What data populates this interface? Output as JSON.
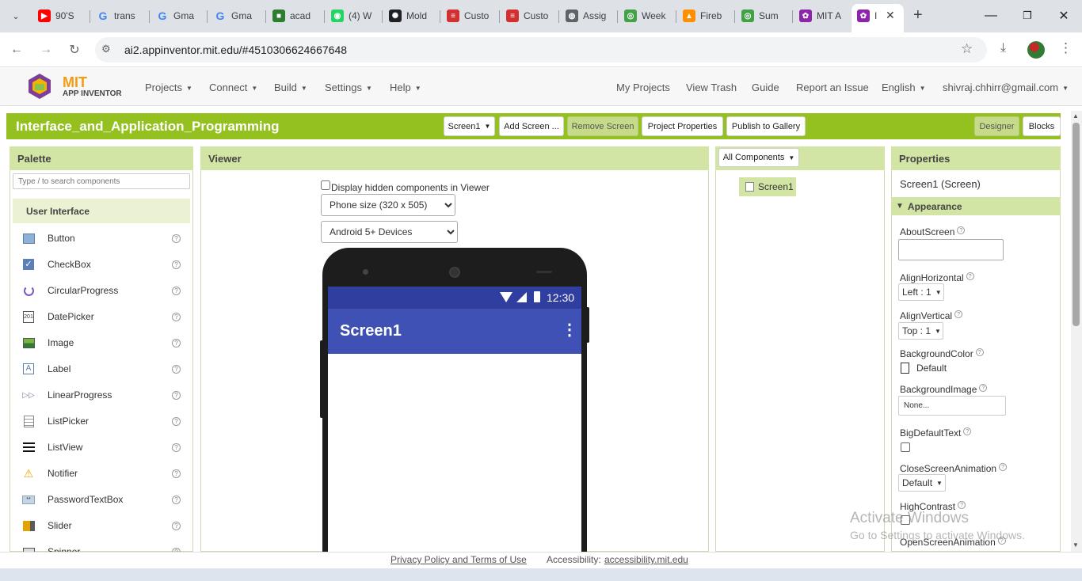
{
  "browser": {
    "tabs": [
      {
        "title": "90'S",
        "icon": "youtube-icon",
        "color": "#ff0000"
      },
      {
        "title": "trans",
        "icon": "google-icon",
        "color": "#4285f4"
      },
      {
        "title": "Gma",
        "icon": "google-icon",
        "color": "#4285f4"
      },
      {
        "title": "Gma",
        "icon": "google-icon",
        "color": "#4285f4"
      },
      {
        "title": "acad",
        "icon": "cube-icon",
        "color": "#2e7d32"
      },
      {
        "title": "(4) W",
        "icon": "whatsapp-icon",
        "color": "#25d366"
      },
      {
        "title": "Mold",
        "icon": "openai-icon",
        "color": "#202124"
      },
      {
        "title": "Custo",
        "icon": "form-icon",
        "color": "#d32f2f"
      },
      {
        "title": "Custo",
        "icon": "form-icon",
        "color": "#d32f2f"
      },
      {
        "title": "Assig",
        "icon": "globe-icon",
        "color": "#5f6368"
      },
      {
        "title": "Week",
        "icon": "chrome-icon",
        "color": "#43a047"
      },
      {
        "title": "Fireb",
        "icon": "firebase-icon",
        "color": "#ff8f00"
      },
      {
        "title": "Sum",
        "icon": "chrome-icon",
        "color": "#43a047"
      },
      {
        "title": "MIT A",
        "icon": "appinventor-icon",
        "color": "#8e24aa"
      },
      {
        "title": "I",
        "icon": "appinventor-icon",
        "color": "#8e24aa"
      }
    ],
    "new_tab": "+",
    "url": "ai2.appinventor.mit.edu/#4510306624667648"
  },
  "app": {
    "logo_mit": "MIT",
    "logo_sub": "APP INVENTOR",
    "menus": [
      "Projects",
      "Connect",
      "Build",
      "Settings",
      "Help"
    ],
    "right_links": [
      "My Projects",
      "View Trash",
      "Guide",
      "Report an Issue",
      "English",
      "shivraj.chhirr@gmail.com"
    ]
  },
  "toolbar": {
    "project_title": "Interface_and_Application_Programming",
    "screen_select": "Screen1",
    "add_screen": "Add Screen ...",
    "remove_screen": "Remove Screen",
    "project_properties": "Project Properties",
    "publish": "Publish to Gallery",
    "designer": "Designer",
    "blocks": "Blocks"
  },
  "palette": {
    "title": "Palette",
    "search_placeholder": "Type / to search components",
    "category": "User Interface",
    "items": [
      "Button",
      "CheckBox",
      "CircularProgress",
      "DatePicker",
      "Image",
      "Label",
      "LinearProgress",
      "ListPicker",
      "ListView",
      "Notifier",
      "PasswordTextBox",
      "Slider",
      "Spinner"
    ],
    "help": "?"
  },
  "viewer": {
    "title": "Viewer",
    "hidden_label": "Display hidden components in Viewer",
    "size_option": "Phone size (320 x 505)",
    "device_option": "Android 5+ Devices",
    "time": "12:30",
    "screen_title": "Screen1"
  },
  "components": {
    "dropdown": "All Components",
    "tree_item": "Screen1"
  },
  "properties": {
    "title": "Properties",
    "subtitle": "Screen1 (Screen)",
    "section": "Appearance",
    "about_label": "AboutScreen",
    "align_h_label": "AlignHorizontal",
    "align_h_value": "Left : 1",
    "align_v_label": "AlignVertical",
    "align_v_value": "Top : 1",
    "bg_color_label": "BackgroundColor",
    "bg_color_value": "Default",
    "bg_image_label": "BackgroundImage",
    "bg_image_value": "None...",
    "big_text_label": "BigDefaultText",
    "close_anim_label": "CloseScreenAnimation",
    "close_anim_value": "Default",
    "high_contrast_label": "HighContrast",
    "open_anim_label": "OpenScreenAnimation"
  },
  "watermark": {
    "line1": "Activate Windows",
    "line2": "Go to Settings to activate Windows."
  },
  "footer": {
    "privacy": "Privacy Policy and Terms of Use",
    "accessibility_label": "Accessibility:",
    "accessibility_link": "accessibility.mit.edu"
  },
  "colors": {
    "accent_green": "#94c11f",
    "panel_green": "#d3e5a5",
    "phone_appbar": "#3f51b5",
    "phone_statusbar": "#303f9f"
  }
}
